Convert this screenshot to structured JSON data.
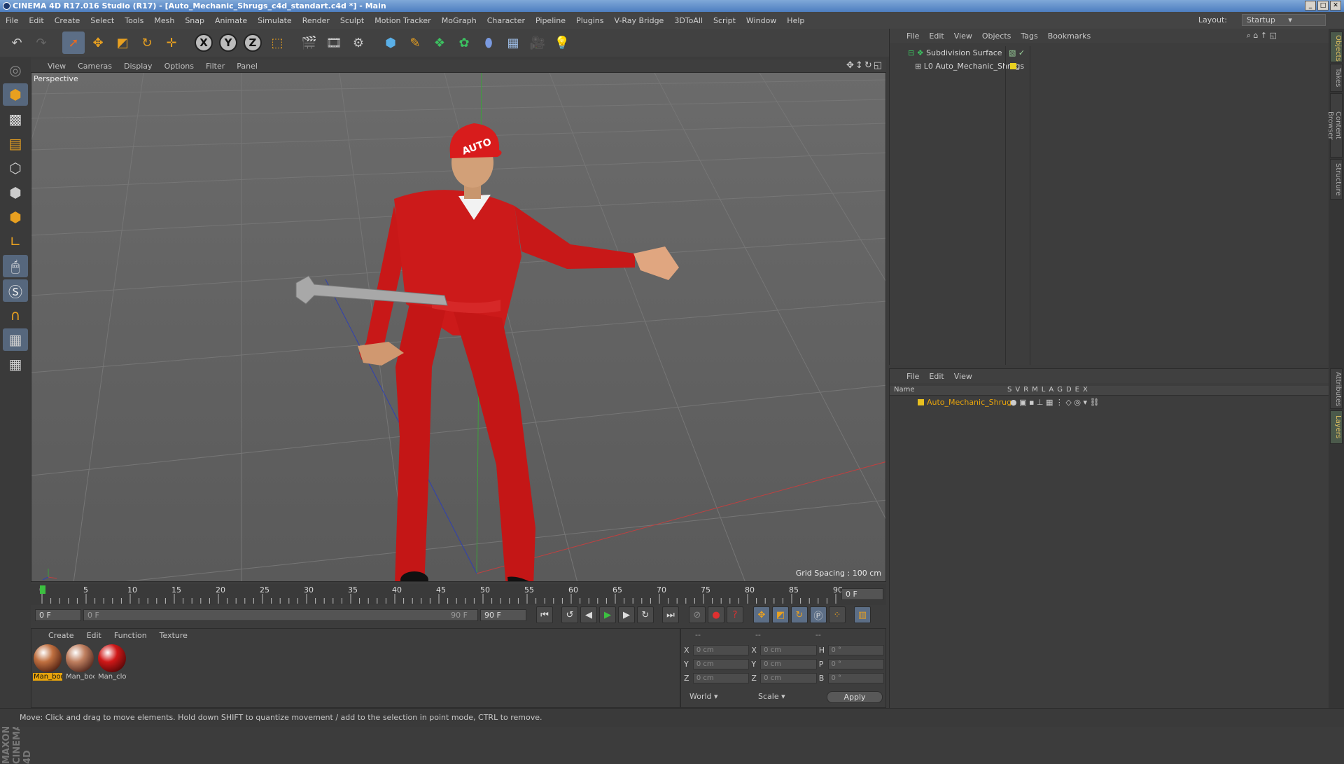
{
  "window": {
    "title": "CINEMA 4D R17.016 Studio (R17) - [Auto_Mechanic_Shrugs_c4d_standart.c4d *] - Main"
  },
  "menubar": {
    "items": [
      "File",
      "Edit",
      "Create",
      "Select",
      "Tools",
      "Mesh",
      "Snap",
      "Animate",
      "Simulate",
      "Render",
      "Sculpt",
      "Motion Tracker",
      "MoGraph",
      "Character",
      "Pipeline",
      "Plugins",
      "V-Ray Bridge",
      "3DToAll",
      "Script",
      "Window",
      "Help"
    ],
    "layout_label": "Layout:",
    "layout_value": "Startup"
  },
  "viewport": {
    "menu": [
      "View",
      "Cameras",
      "Display",
      "Options",
      "Filter",
      "Panel"
    ],
    "label": "Perspective",
    "grid_spacing": "Grid Spacing : 100 cm"
  },
  "timeline": {
    "ticks": [
      "0",
      "5",
      "10",
      "15",
      "20",
      "25",
      "30",
      "35",
      "40",
      "45",
      "50",
      "55",
      "60",
      "65",
      "70",
      "75",
      "80",
      "85",
      "90"
    ],
    "current_frame": "0 F",
    "start": "0 F",
    "range_start": "0 F",
    "range_end": "90 F",
    "end": "90 F"
  },
  "material_manager": {
    "menu": [
      "Create",
      "Edit",
      "Function",
      "Texture"
    ],
    "materials": [
      {
        "name": "Man_bod",
        "color": "#c07040"
      },
      {
        "name": "Man_boc",
        "color": "#c08060"
      },
      {
        "name": "Man_clot",
        "color": "#d01818"
      }
    ]
  },
  "coordinates": {
    "header": [
      "--",
      "--",
      "--"
    ],
    "rows": [
      {
        "a": "X",
        "v1": "0 cm",
        "b": "X",
        "v2": "0 cm",
        "c": "H",
        "v3": "0 °"
      },
      {
        "a": "Y",
        "v1": "0 cm",
        "b": "Y",
        "v2": "0 cm",
        "c": "P",
        "v3": "0 °"
      },
      {
        "a": "Z",
        "v1": "0 cm",
        "b": "Z",
        "v2": "0 cm",
        "c": "B",
        "v3": "0 °"
      }
    ],
    "mode1": "World",
    "mode2": "Scale",
    "apply": "Apply"
  },
  "object_manager": {
    "menu": [
      "File",
      "Edit",
      "View",
      "Objects",
      "Tags",
      "Bookmarks"
    ],
    "objects": [
      "Subdivision Surface",
      "Auto_Mechanic_Shrugs"
    ]
  },
  "layer_manager": {
    "menu": [
      "File",
      "Edit",
      "View"
    ],
    "name_header": "Name",
    "columns": [
      "S",
      "V",
      "R",
      "M",
      "L",
      "A",
      "G",
      "D",
      "E",
      "X"
    ],
    "layer": "Auto_Mechanic_Shrugs",
    "layer_color": "#e8c020"
  },
  "side_tabs": [
    "Objects",
    "Takes",
    "Content Browser",
    "Structure",
    "Attributes",
    "Layers"
  ],
  "status": "Move: Click and drag to move elements. Hold down SHIFT to quantize movement / add to the selection in point mode, CTRL to remove."
}
